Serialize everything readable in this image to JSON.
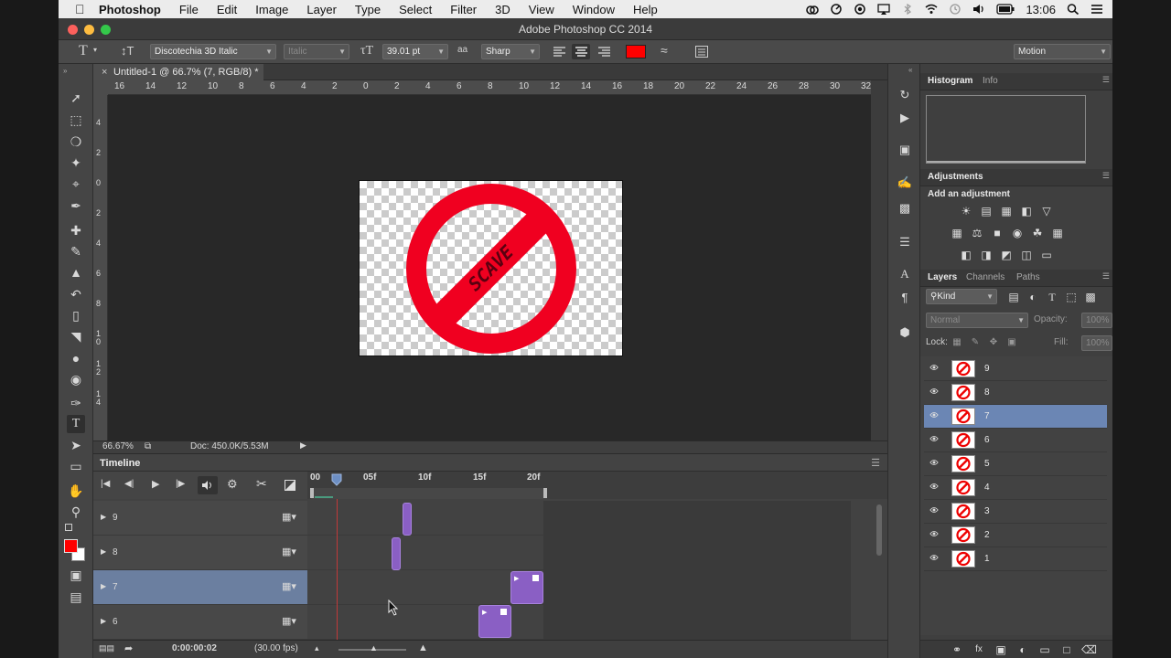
{
  "menubar": {
    "app": "Photoshop",
    "items": [
      "File",
      "Edit",
      "Image",
      "Layer",
      "Type",
      "Select",
      "Filter",
      "3D",
      "View",
      "Window",
      "Help"
    ],
    "clock": "13:06"
  },
  "window": {
    "title": "Adobe Photoshop CC 2014"
  },
  "options": {
    "font_family": "Discotechia 3D Italic",
    "font_style": "Italic",
    "font_size": "39.01 pt",
    "antialias": "Sharp",
    "text_color": "#ff0000",
    "workspace": "Motion"
  },
  "document": {
    "tab_title": "Untitled-1 @ 66.7% (7, RGB/8) *",
    "zoom": "66.67%",
    "doc_info": "Doc: 450.0K/5.53M",
    "hruler_labels": [
      "16",
      "14",
      "12",
      "10",
      "8",
      "6",
      "4",
      "2",
      "0",
      "2",
      "4",
      "6",
      "8",
      "10",
      "12",
      "14",
      "16",
      "18",
      "20",
      "22",
      "24",
      "26",
      "28",
      "30",
      "32"
    ],
    "vruler_labels": [
      "4",
      "2",
      "0",
      "2",
      "4",
      "6",
      "8",
      "1\n0",
      "1\n2",
      "1\n4"
    ],
    "canvas_text": "SCAVE"
  },
  "timeline": {
    "title": "Timeline",
    "ruler_labels": [
      "00",
      "05f",
      "10f",
      "15f",
      "20f"
    ],
    "tracks": [
      {
        "name": "9",
        "selected": false
      },
      {
        "name": "8",
        "selected": false
      },
      {
        "name": "7",
        "selected": true
      },
      {
        "name": "6",
        "selected": false
      }
    ],
    "timecode": "0:00:00:02",
    "fps": "(30.00 fps)"
  },
  "panels": {
    "histogram_tabs": [
      "Histogram",
      "Info"
    ],
    "adjustments_title": "Adjustments",
    "adjustments_hint": "Add an adjustment",
    "layers_tabs": [
      "Layers",
      "Channels",
      "Paths"
    ],
    "filter_kind": "Kind",
    "blend_mode": "Normal",
    "opacity_label": "Opacity:",
    "opacity_value": "100%",
    "lock_label": "Lock:",
    "fill_label": "Fill:",
    "fill_value": "100%",
    "layers": [
      {
        "name": "9",
        "selected": false
      },
      {
        "name": "8",
        "selected": false
      },
      {
        "name": "7",
        "selected": true
      },
      {
        "name": "6",
        "selected": false
      },
      {
        "name": "5",
        "selected": false
      },
      {
        "name": "4",
        "selected": false
      },
      {
        "name": "3",
        "selected": false
      },
      {
        "name": "2",
        "selected": false
      },
      {
        "name": "1",
        "selected": false
      }
    ]
  }
}
